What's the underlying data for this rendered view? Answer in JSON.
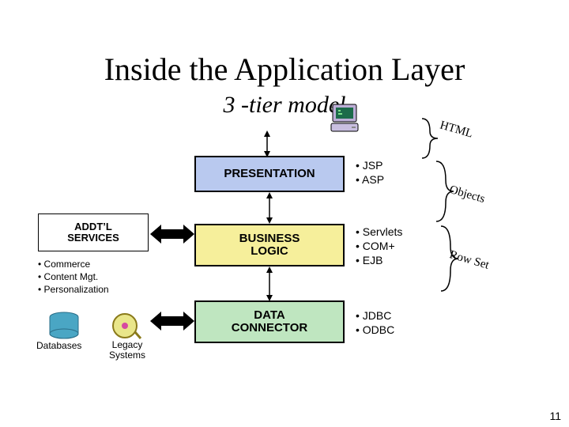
{
  "title": "Inside the Application Layer",
  "subtitle": "3 -tier model",
  "slide_number": "11",
  "tiers": {
    "presentation": "PRESENTATION",
    "business": "BUSINESS\nLOGIC",
    "data": "DATA\nCONNECTOR"
  },
  "tier_tech": {
    "presentation": [
      "JSP",
      "ASP"
    ],
    "business": [
      "Servlets",
      "COM+",
      "EJB"
    ],
    "data": [
      "JDBC",
      "ODBC"
    ]
  },
  "link_labels": {
    "l1": "HTML",
    "l2": "Objects",
    "l3": "Row Set"
  },
  "addtl": {
    "title": "ADDT’L\nSERVICES",
    "items": [
      "Commerce",
      "Content Mgt.",
      "Personalization"
    ]
  },
  "datastores": {
    "databases": "Databases",
    "legacy": "Legacy\nSystems"
  }
}
